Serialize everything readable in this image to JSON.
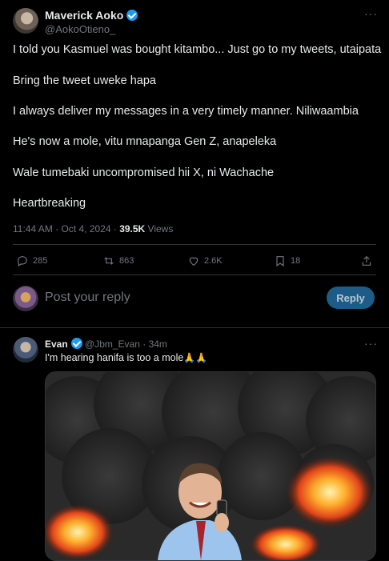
{
  "main_tweet": {
    "author_name": "Maverick Aoko",
    "author_handle": "@AokoOtieno_",
    "lines": [
      "I told you Kasmuel was bought kitambo... Just go to my tweets, utaipata",
      "Bring the tweet uweke hapa",
      "I always deliver my messages in a very timely manner. Niliwaambia",
      "He's now a mole, vitu mnapanga Gen Z, anapeleka",
      "Wale tumebaki uncompromised hii X, ni Wachache",
      "Heartbreaking"
    ],
    "timestamp": "11:44 AM · Oct 4, 2024 · ",
    "views_count": "39.5K",
    "views_label": " Views",
    "actions": {
      "replies": "285",
      "reposts": "863",
      "likes": "2.6K",
      "bookmarks": "18"
    }
  },
  "reply_box": {
    "placeholder": "Post your reply",
    "button_label": "Reply"
  },
  "reply_tweet": {
    "author_name": "Evan",
    "author_handle": "@Jbm_Evan",
    "time": " · 34m",
    "text": "I'm hearing hanifa is too a mole",
    "emoji": "🙏🙏"
  },
  "colors": {
    "background": "#000000",
    "text": "#e7e9ea",
    "muted": "#71767b",
    "accent": "#1d9bf0",
    "divider": "#2f3336"
  }
}
